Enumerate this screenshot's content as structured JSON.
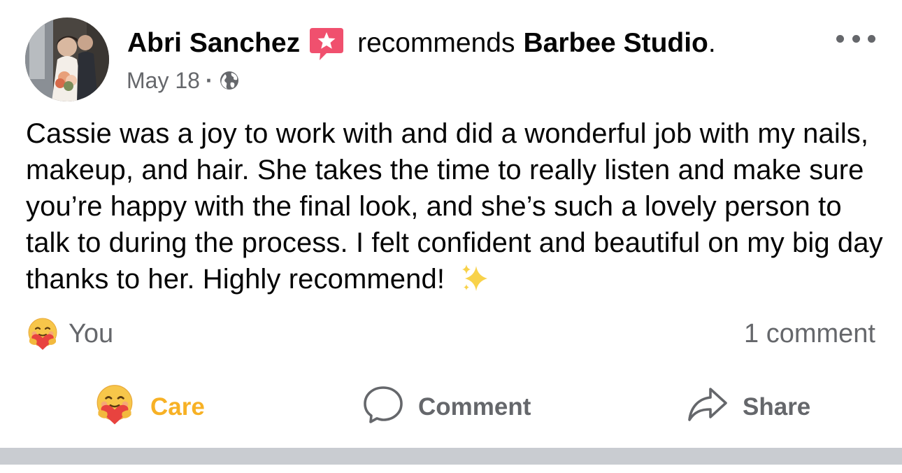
{
  "post": {
    "author": "Abri Sanchez",
    "recommends_text": "recommends",
    "page_name": "Barbee Studio",
    "period": ".",
    "date": "May 18",
    "meta_separator": "·",
    "body": "Cassie was a joy to work with and did a wonderful job with my nails, makeup, and hair. She takes the time to really listen and make sure you’re happy with the final look, and she’s such a lovely person to talk to during the process. I felt confident and beautiful on my big day thanks to her. Highly recommend!",
    "body_emoji": "sparkles-icon",
    "reactions_label": "You",
    "comment_count_label": "1 comment"
  },
  "actions": {
    "care_label": "Care",
    "comment_label": "Comment",
    "share_label": "Share"
  },
  "colors": {
    "text": "#050505",
    "secondary": "#65676b",
    "care": "#f7b125",
    "recommend_badge": "#f0506e",
    "separator": "#c9ccd1"
  },
  "icons": {
    "avatar": "avatar-photo",
    "recommend": "recommend-star-icon",
    "audience": "globe-icon",
    "more": "more-options-icon",
    "care": "care-emoji-icon",
    "comment": "comment-bubble-icon",
    "share": "share-arrow-icon"
  }
}
